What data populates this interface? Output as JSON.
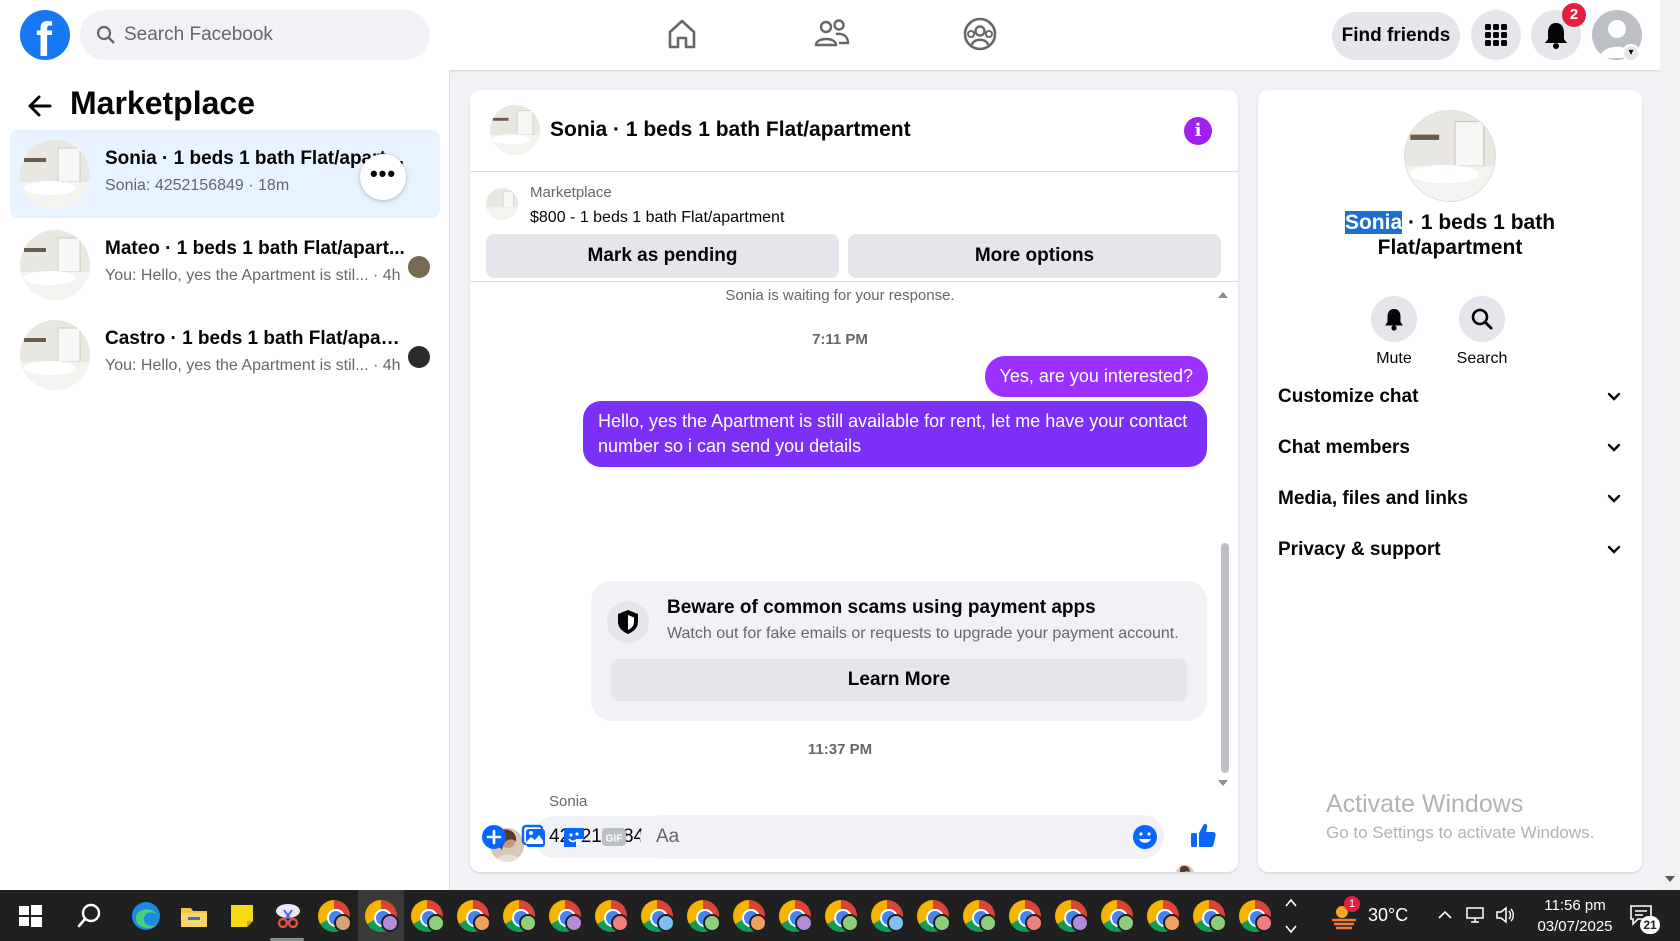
{
  "topbar": {
    "search_placeholder": "Search Facebook",
    "find_friends": "Find friends",
    "notif_count": "2"
  },
  "left": {
    "title": "Marketplace",
    "conversations": [
      {
        "title": "Sonia · 1 beds 1 bath Flat/apartment",
        "sub": "Sonia: 4252156849 · 18m",
        "active": true
      },
      {
        "title": "Mateo · 1 beds 1 bath Flat/apart...",
        "sub": "You: Hello, yes the Apartment is stil... · 4h",
        "active": false
      },
      {
        "title": "Castro · 1 beds 1 bath Flat/apart...",
        "sub": "You: Hello, yes the Apartment is stil... · 4h",
        "active": false
      }
    ]
  },
  "chat": {
    "title": "Sonia · 1 beds 1 bath Flat/apartment",
    "listing_label": "Marketplace",
    "listing_price": "$800 - 1 beds 1 bath Flat/apartment",
    "mark_pending": "Mark as pending",
    "more_options": "More options",
    "waiting": "Sonia is waiting for your response.",
    "time1": "7:11 PM",
    "msg1": "Yes, are you interested?",
    "msg2": "Hello, yes the Apartment is still available for rent, let me have your contact number so i can send you details",
    "scam_title": "Beware of common scams using payment apps",
    "scam_desc": "Watch out for fake emails or requests to upgrade your payment account.",
    "learn_more": "Learn More",
    "time2": "11:37 PM",
    "sender": "Sonia",
    "msg3": "4252156849",
    "composer_placeholder": "Aa"
  },
  "right": {
    "title_name": "Sonia",
    "title_rest": " · 1 beds 1 bath Flat/apartment",
    "mute": "Mute",
    "search": "Search",
    "rows": [
      "Customize chat",
      "Chat members",
      "Media, files and links",
      "Privacy & support"
    ],
    "activate_title": "Activate Windows",
    "activate_sub": "Go to Settings to activate Windows."
  },
  "taskbar": {
    "weather_temp": "30°C",
    "weather_badge": "1",
    "time": "11:56 pm",
    "date": "03/07/2025",
    "notif_count": "21"
  },
  "colors": {
    "brand": "#1877f2",
    "bubble_out": "#8a2be2",
    "active_row": "#e7f3ff"
  }
}
